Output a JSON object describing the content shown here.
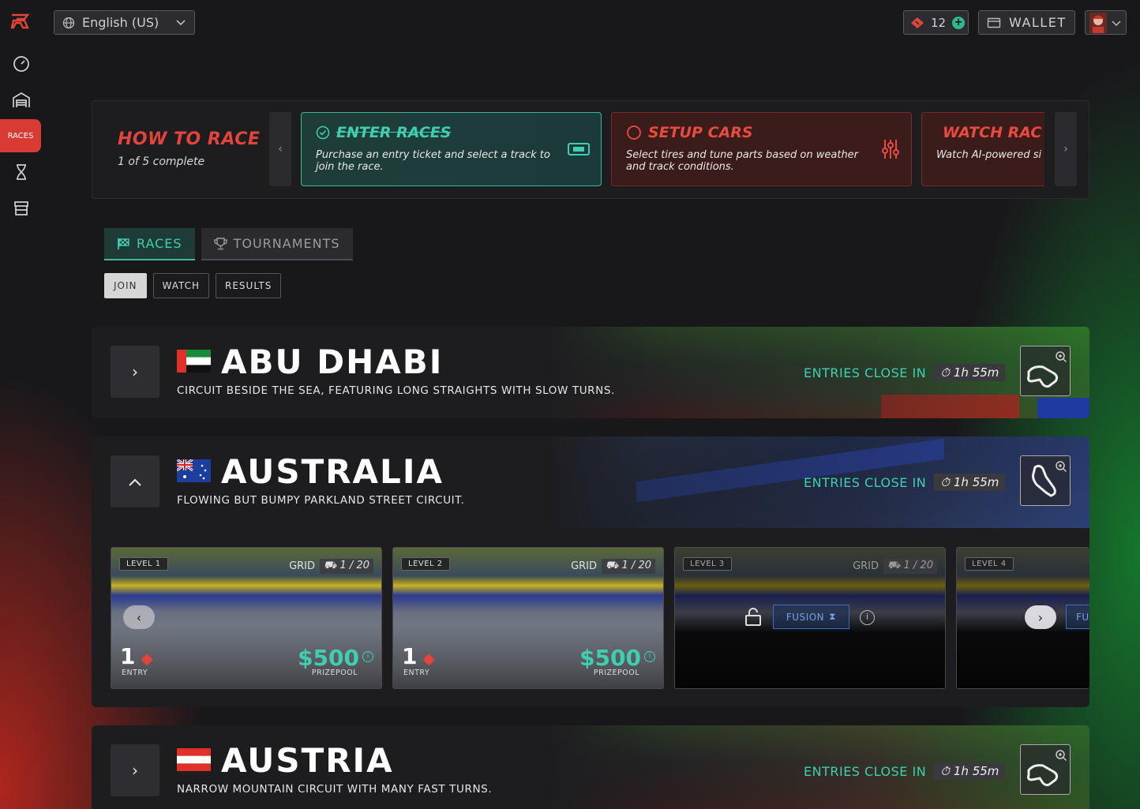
{
  "topbar": {
    "language": "English (US)",
    "tickets": "12",
    "wallet": "WALLET"
  },
  "sidebar": {
    "active_label": "RACES",
    "icons": [
      "speedometer-icon",
      "garage-icon",
      "dna-icon",
      "store-icon"
    ]
  },
  "how_to": {
    "title": "HOW TO RACE",
    "progress": "1 of 5 complete",
    "steps": [
      {
        "title": "ENTER RACES",
        "desc": "Purchase an entry ticket and select a track to join the race.",
        "done": true
      },
      {
        "title": "SETUP CARS",
        "desc": "Select tires and tune parts based on weather and track conditions.",
        "done": false
      },
      {
        "title": "WATCH RAC",
        "desc": "Watch AI-powered si strategy to life on th",
        "done": false
      }
    ]
  },
  "tabs": {
    "races": "RACES",
    "tournaments": "TOURNAMENTS"
  },
  "subtabs": {
    "join": "JOIN",
    "watch": "WATCH",
    "results": "RESULTS"
  },
  "races": [
    {
      "name": "ABU DHABI",
      "desc": "CIRCUIT BESIDE THE SEA, FEATURING LONG STRAIGHTS WITH SLOW TURNS.",
      "entries_label": "ENTRIES CLOSE IN",
      "timer": "1h 55m"
    },
    {
      "name": "AUSTRALIA",
      "desc": "FLOWING BUT BUMPY PARKLAND STREET CIRCUIT.",
      "entries_label": "ENTRIES CLOSE IN",
      "timer": "1h 55m"
    },
    {
      "name": "AUSTRIA",
      "desc": "NARROW MOUNTAIN CIRCUIT WITH MANY FAST TURNS.",
      "entries_label": "ENTRIES CLOSE IN",
      "timer": "1h 55m"
    }
  ],
  "levels": [
    {
      "level": "LEVEL 1",
      "grid_label": "GRID",
      "grid": "1 / 20",
      "entry": "1",
      "entry_label": "ENTRY",
      "prize": "$500",
      "prize_label": "PRIZEPOOL"
    },
    {
      "level": "LEVEL 2",
      "grid_label": "GRID",
      "grid": "1 / 20",
      "entry": "1",
      "entry_label": "ENTRY",
      "prize": "$500",
      "prize_label": "PRIZEPOOL"
    },
    {
      "level": "LEVEL 3",
      "grid_label": "GRID",
      "grid": "1 / 20",
      "fusion": "FUSION"
    },
    {
      "level": "LEVEL 4",
      "fusion": "FUSI"
    }
  ],
  "colors": {
    "accent_teal": "#3fcfb0",
    "accent_red": "#e0443b",
    "background": "#18181b"
  }
}
